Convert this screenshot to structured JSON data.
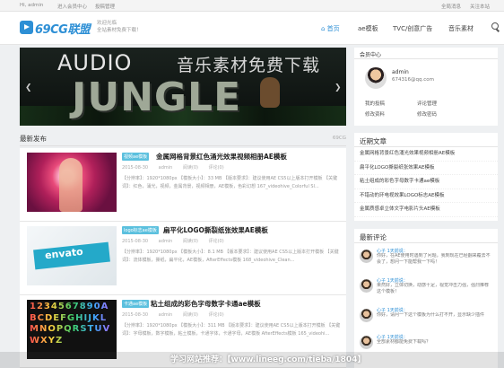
{
  "topbar": {
    "greeting": "Hi, admin",
    "member_center": "进入会员中心",
    "publish": "投稿管理",
    "notify": "全局消息",
    "follow": "关注本站"
  },
  "header": {
    "logo_text": "69CG联盟",
    "slogan_line1": "欢迎光临",
    "slogan_line2": "全站素材免费下载！",
    "nav": [
      "首页",
      "ae模板",
      "TVC/创意广告",
      "音乐素材"
    ]
  },
  "banner": {
    "text_en": "AUDIO",
    "text_cn": "音乐素材免费下载",
    "text_big": "JUNGLE"
  },
  "latest": {
    "title": "最新发布",
    "more": "69CG"
  },
  "posts": [
    {
      "tag": "视频ae模板",
      "title": "金属网格背景红色涌光效果视频相册AE模板",
      "date": "2015-08-30",
      "author": "admin",
      "views": "阅读(0)",
      "comments": "评论(0)",
      "desc": "【分辨率】：1920*1080px 【模板大小】：33 MB 【版本要求】：建议使用AE CS5以上版本打开模板 【关键词】：红色，涌光，视频，金属背景，视频相册，AE模板，色彩幻想 167_videohive_Colorful Sl..."
    },
    {
      "tag": "logo标志ae模板",
      "title": "扁平化LOGO撕裂纸张效果AE模板",
      "date": "2015-08-30",
      "author": "admin",
      "views": "阅读(0)",
      "comments": "评论(0)",
      "desc": "【分辨率】：1920*1080px 【模板大小】：8.1 MB 【版本要求】：建议使用AE CS5以上版本打开模板 【关键词】：流体模板，撕纸，扁平化，AE模板，AfterEffects模板 168_videohive_Clean..."
    },
    {
      "tag": "卡通ae模板",
      "title": "粘土组成的彩色字母数字卡通ae模板",
      "date": "2015-08-30",
      "author": "admin",
      "views": "阅读(0)",
      "comments": "评论(0)",
      "desc": "【分辨率】：1920*1080px 【模板大小】：311 MB 【版本要求】：建议使用AE CS5以上版本打开模板 【关键词】：字母模板，数字模板，粘土模板，卡通字体，卡通字母，AE模板 AfterEffects模板 165_videohi..."
    }
  ],
  "member": {
    "title": "会员中心",
    "name": "admin",
    "email": "674316@qq.com",
    "links": [
      "我的投稿",
      "评论管理",
      "修改资料",
      "修改密码"
    ]
  },
  "recent": {
    "title": "近期文章",
    "items": [
      "金属网格背景红色涌光效果视频相册AE模板",
      "扁平化LOGO撕裂纸张效果AE模板",
      "粘土组成的彩色字母数字卡通ae模板",
      "不错动的环电视效果LOGO标志AE模板",
      "金属质感卓立体文字电影片头AE模板"
    ]
  },
  "comments": {
    "title": "最新评论",
    "items": [
      {
        "name": "心子 1天前说：",
        "text": "你好，在AE使用时遇到了问题，我到现在已经翻来覆去不会了，想问一下能帮我一下吗！"
      },
      {
        "name": "心子 1天前说：",
        "text": "果然好，立体切换，动感十足，视觉冲击力强，强烈推荐这个模板！"
      },
      {
        "name": "心子 1天前说：",
        "text": "你好，请问一下这个模板为什么打不开，显示缺少插件"
      },
      {
        "name": "心子 1天前说：",
        "text": "全部素材都能免费下载吗？"
      }
    ]
  },
  "watermark": "学习网站推荐：【www.lineeg.com/tieba/1804】"
}
